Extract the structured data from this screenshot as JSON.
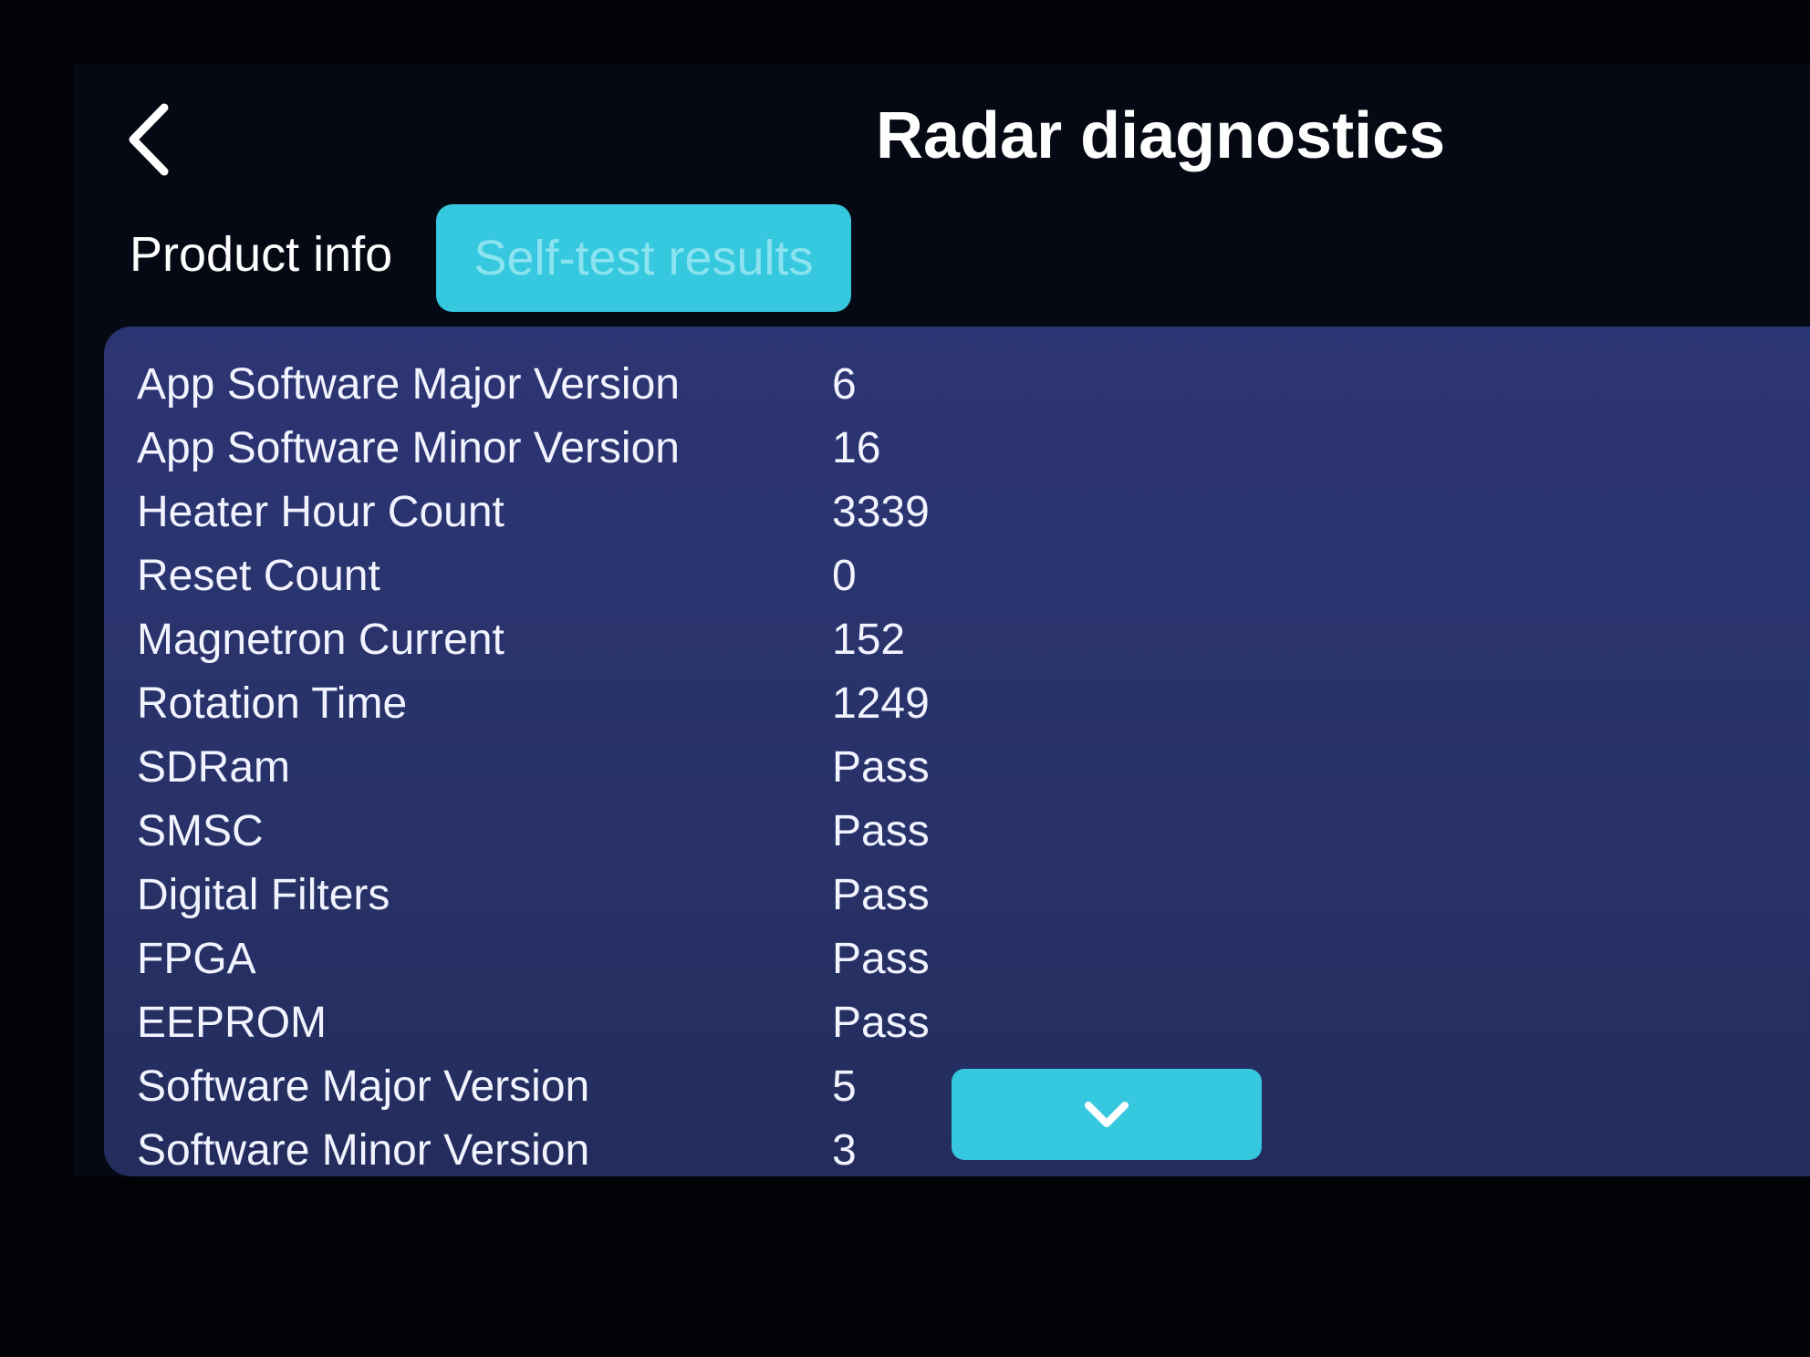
{
  "header": {
    "title": "Radar diagnostics",
    "back_icon": "chevron-left-icon"
  },
  "tabs": [
    {
      "label": "Product info",
      "active": false
    },
    {
      "label": "Self-test results",
      "active": true
    }
  ],
  "results": [
    {
      "label": "App Software Major Version",
      "value": "6"
    },
    {
      "label": "App Software Minor Version",
      "value": "16"
    },
    {
      "label": "Heater Hour Count",
      "value": "3339"
    },
    {
      "label": "Reset Count",
      "value": "0"
    },
    {
      "label": "Magnetron Current",
      "value": "152"
    },
    {
      "label": "Rotation Time",
      "value": "1249"
    },
    {
      "label": "SDRam",
      "value": "Pass"
    },
    {
      "label": "SMSC",
      "value": "Pass"
    },
    {
      "label": "Digital Filters",
      "value": "Pass"
    },
    {
      "label": "FPGA",
      "value": "Pass"
    },
    {
      "label": "EEPROM",
      "value": "Pass"
    },
    {
      "label": "Software Major Version",
      "value": "5"
    },
    {
      "label": "Software Minor Version",
      "value": "3"
    }
  ],
  "scroll_button": {
    "icon": "chevron-down-icon"
  },
  "colors": {
    "accent": "#35c8de",
    "panel": "#2a336e",
    "background": "#050913",
    "text": "#ffffff"
  }
}
